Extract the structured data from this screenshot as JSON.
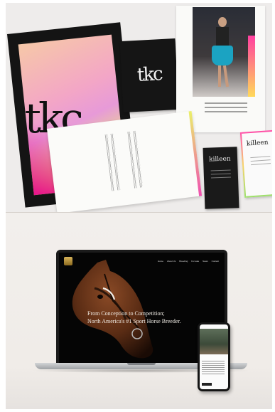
{
  "branding": {
    "poster_logo": "tkc",
    "square_card_logo": "tkc",
    "business_card_dark_name": "killeen",
    "business_card_light_name": "killeen"
  },
  "website": {
    "nav_items": [
      "Home",
      "About Us",
      "Breeding",
      "For sale",
      "News",
      "Contact"
    ],
    "hero_line1": "From Conception to Competition;",
    "hero_line2": "North America's #1 Sport Horse Breeder."
  },
  "colors": {
    "gradient_pink": "#e8108c",
    "gradient_peach": "#f6c8a8",
    "gradient_lime": "#eaf06a",
    "site_background": "#050505",
    "logo_gold": "#d8b45a"
  }
}
